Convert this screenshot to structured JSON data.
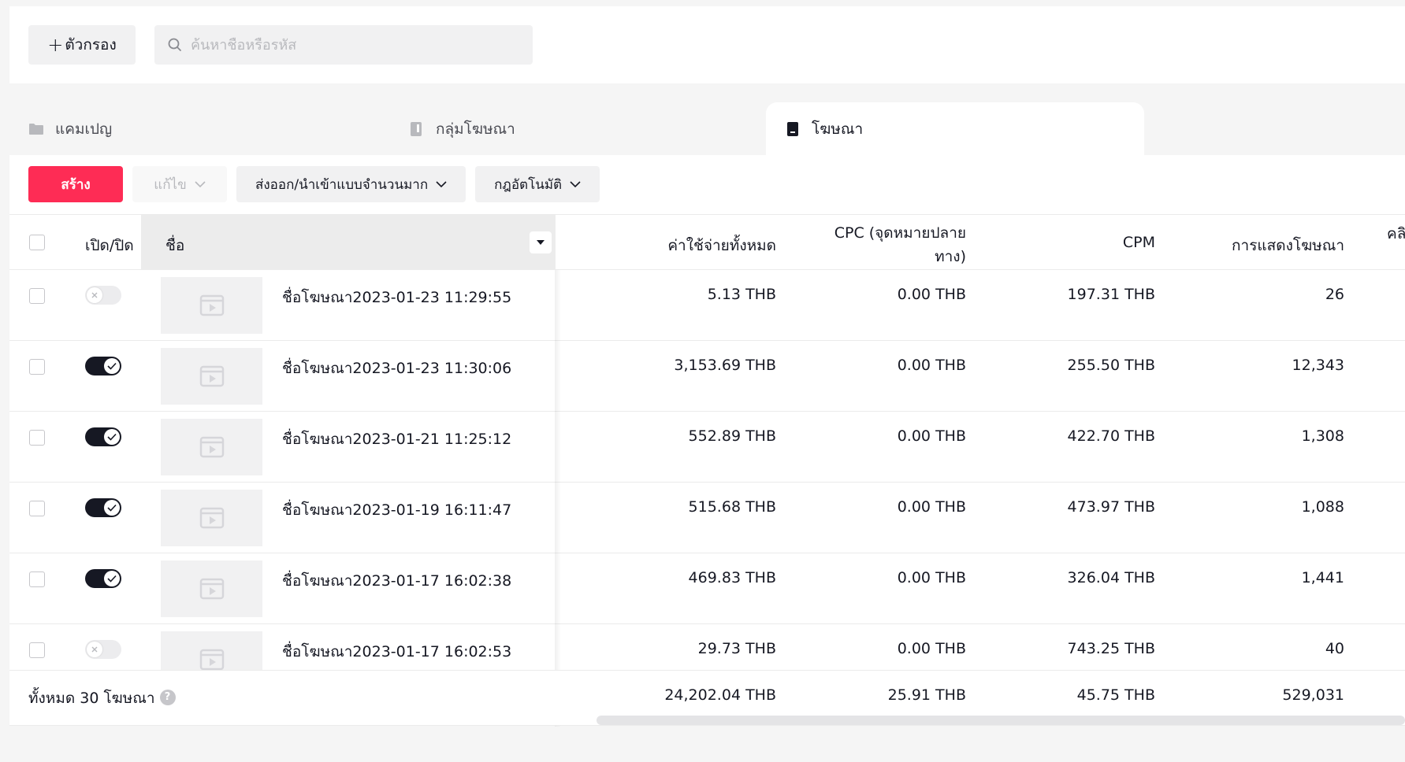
{
  "toolbar_top": {
    "filter_label": "ตัวกรอง",
    "search_placeholder": "ค้นหาชื่อหรือรหัส"
  },
  "tabs": [
    {
      "label": "แคมเปญ",
      "icon": "folder-icon",
      "active": false
    },
    {
      "label": "กลุ่มโฆษณา",
      "icon": "ad-group-icon",
      "active": false
    },
    {
      "label": "โฆษณา",
      "icon": "ad-icon",
      "active": true
    }
  ],
  "actions": {
    "create": "สร้าง",
    "edit": "แก้ไข",
    "bulk": "ส่งออก/นำเข้าแบบจำนวนมาก",
    "rules": "กฎอัตโนมัติ"
  },
  "colors": {
    "primary": "#fe2c55",
    "toggle_on": "#161823",
    "toggle_off": "#ececee"
  },
  "table": {
    "headers": {
      "onoff": "เปิด/ปิด",
      "name": "ชื่อ",
      "cost": "ค่าใช้จ่ายทั้งหมด",
      "cpc_line1": "CPC (จุดหมายปลาย",
      "cpc_line2": "ทาง)",
      "cpm": "CPM",
      "impressions": "การแสดงโฆษณา",
      "clicks_partial": "คลิ"
    },
    "rows": [
      {
        "enabled": false,
        "name": "ชื่อโฆษณา2023-01-23 11:29:55",
        "cost": "5.13 THB",
        "cpc": "0.00 THB",
        "cpm": "197.31 THB",
        "impressions": "26"
      },
      {
        "enabled": true,
        "name": "ชื่อโฆษณา2023-01-23 11:30:06",
        "cost": "3,153.69 THB",
        "cpc": "0.00 THB",
        "cpm": "255.50 THB",
        "impressions": "12,343"
      },
      {
        "enabled": true,
        "name": "ชื่อโฆษณา2023-01-21 11:25:12",
        "cost": "552.89 THB",
        "cpc": "0.00 THB",
        "cpm": "422.70 THB",
        "impressions": "1,308"
      },
      {
        "enabled": true,
        "name": "ชื่อโฆษณา2023-01-19 16:11:47",
        "cost": "515.68 THB",
        "cpc": "0.00 THB",
        "cpm": "473.97 THB",
        "impressions": "1,088"
      },
      {
        "enabled": true,
        "name": "ชื่อโฆษณา2023-01-17 16:02:38",
        "cost": "469.83 THB",
        "cpc": "0.00 THB",
        "cpm": "326.04 THB",
        "impressions": "1,441"
      },
      {
        "enabled": false,
        "name": "ชื่อโฆษณา2023-01-17 16:02:53",
        "cost": "29.73 THB",
        "cpc": "0.00 THB",
        "cpm": "743.25 THB",
        "impressions": "40"
      }
    ],
    "footer": {
      "total_label": "ทั้งหมด 30 โฆษณา",
      "cost": "24,202.04 THB",
      "cpc": "25.91 THB",
      "cpm": "45.75 THB",
      "impressions": "529,031"
    }
  }
}
